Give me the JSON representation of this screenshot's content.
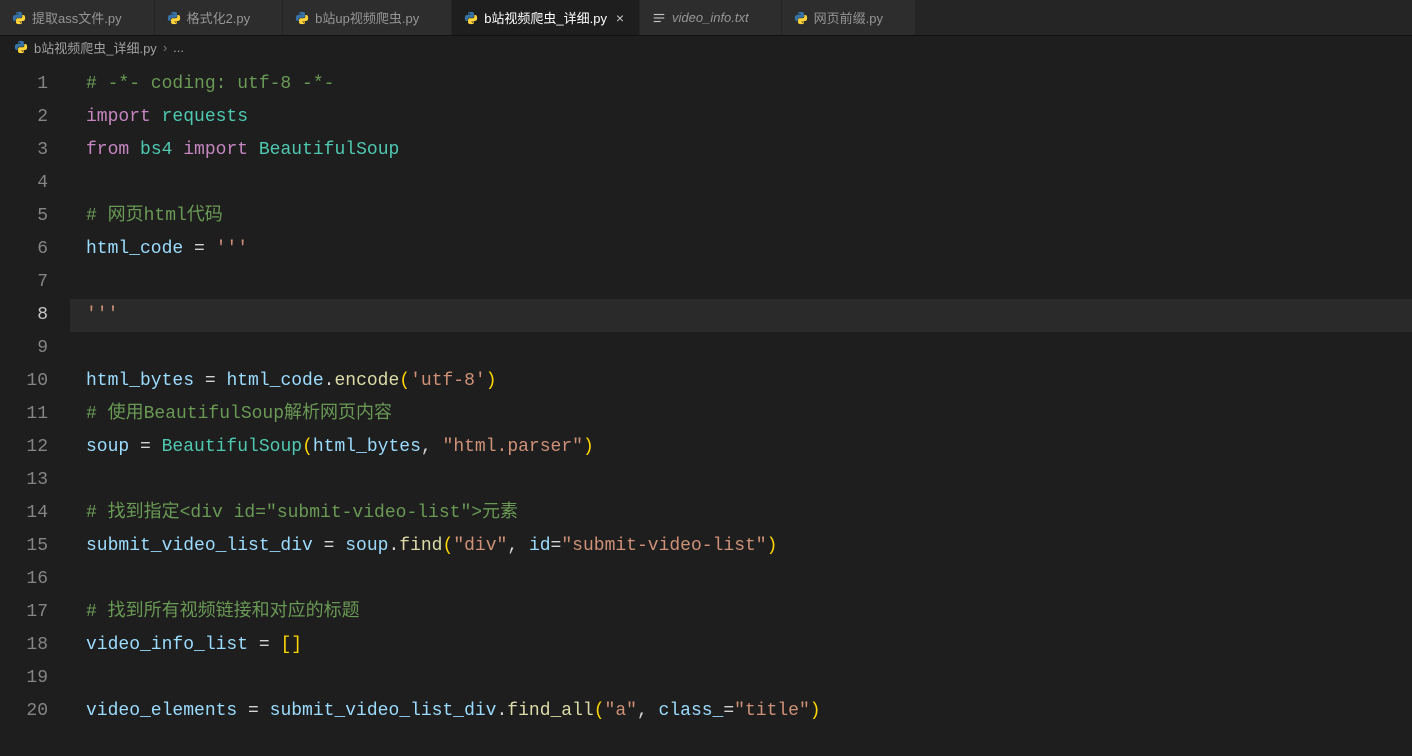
{
  "tabs": [
    {
      "label": "提取ass文件.py",
      "icon": "python",
      "active": false,
      "italic": false
    },
    {
      "label": "格式化2.py",
      "icon": "python",
      "active": false,
      "italic": false
    },
    {
      "label": "b站up视频爬虫.py",
      "icon": "python",
      "active": false,
      "italic": false
    },
    {
      "label": "b站视频爬虫_详细.py",
      "icon": "python",
      "active": true,
      "italic": false
    },
    {
      "label": "video_info.txt",
      "icon": "text",
      "active": false,
      "italic": true
    },
    {
      "label": "网页前缀.py",
      "icon": "python",
      "active": false,
      "italic": false
    }
  ],
  "breadcrumb": {
    "file_icon": "python",
    "file": "b站视频爬虫_详细.py",
    "separator": "›",
    "trail": "..."
  },
  "editor": {
    "current_line": 8,
    "lines": [
      {
        "n": 1,
        "tokens": [
          {
            "t": "# -*- coding: utf-8 -*-",
            "c": "c-comment"
          }
        ]
      },
      {
        "n": 2,
        "tokens": [
          {
            "t": "import",
            "c": "c-keyword"
          },
          {
            "t": " ",
            "c": "c-op"
          },
          {
            "t": "requests",
            "c": "c-module"
          }
        ]
      },
      {
        "n": 3,
        "tokens": [
          {
            "t": "from",
            "c": "c-keyword"
          },
          {
            "t": " ",
            "c": "c-op"
          },
          {
            "t": "bs4",
            "c": "c-module"
          },
          {
            "t": " ",
            "c": "c-op"
          },
          {
            "t": "import",
            "c": "c-keyword"
          },
          {
            "t": " ",
            "c": "c-op"
          },
          {
            "t": "BeautifulSoup",
            "c": "c-module"
          }
        ]
      },
      {
        "n": 4,
        "tokens": []
      },
      {
        "n": 5,
        "tokens": [
          {
            "t": "# 网页html代码",
            "c": "c-comment"
          }
        ]
      },
      {
        "n": 6,
        "tokens": [
          {
            "t": "html_code",
            "c": "c-var"
          },
          {
            "t": " = ",
            "c": "c-op"
          },
          {
            "t": "'''",
            "c": "c-string"
          }
        ]
      },
      {
        "n": 7,
        "tokens": []
      },
      {
        "n": 8,
        "tokens": [
          {
            "t": "'''",
            "c": "c-string"
          }
        ]
      },
      {
        "n": 9,
        "tokens": []
      },
      {
        "n": 10,
        "tokens": [
          {
            "t": "html_bytes",
            "c": "c-var"
          },
          {
            "t": " = ",
            "c": "c-op"
          },
          {
            "t": "html_code",
            "c": "c-var"
          },
          {
            "t": ".",
            "c": "c-op"
          },
          {
            "t": "encode",
            "c": "c-func"
          },
          {
            "t": "(",
            "c": "c-paren gold"
          },
          {
            "t": "'utf-8'",
            "c": "c-string"
          },
          {
            "t": ")",
            "c": "c-paren gold"
          }
        ]
      },
      {
        "n": 11,
        "tokens": [
          {
            "t": "# 使用BeautifulSoup解析网页内容",
            "c": "c-comment"
          }
        ]
      },
      {
        "n": 12,
        "tokens": [
          {
            "t": "soup",
            "c": "c-var"
          },
          {
            "t": " = ",
            "c": "c-op"
          },
          {
            "t": "BeautifulSoup",
            "c": "c-class"
          },
          {
            "t": "(",
            "c": "c-paren gold"
          },
          {
            "t": "html_bytes",
            "c": "c-var"
          },
          {
            "t": ", ",
            "c": "c-op"
          },
          {
            "t": "\"html.parser\"",
            "c": "c-string"
          },
          {
            "t": ")",
            "c": "c-paren gold"
          }
        ]
      },
      {
        "n": 13,
        "tokens": []
      },
      {
        "n": 14,
        "tokens": [
          {
            "t": "# 找到指定<div id=\"submit-video-list\">元素",
            "c": "c-comment"
          }
        ]
      },
      {
        "n": 15,
        "tokens": [
          {
            "t": "submit_video_list_div",
            "c": "c-var"
          },
          {
            "t": " = ",
            "c": "c-op"
          },
          {
            "t": "soup",
            "c": "c-var"
          },
          {
            "t": ".",
            "c": "c-op"
          },
          {
            "t": "find",
            "c": "c-func"
          },
          {
            "t": "(",
            "c": "c-paren gold"
          },
          {
            "t": "\"div\"",
            "c": "c-string"
          },
          {
            "t": ", ",
            "c": "c-op"
          },
          {
            "t": "id",
            "c": "c-var"
          },
          {
            "t": "=",
            "c": "c-op"
          },
          {
            "t": "\"submit-video-list\"",
            "c": "c-string"
          },
          {
            "t": ")",
            "c": "c-paren gold"
          }
        ]
      },
      {
        "n": 16,
        "tokens": []
      },
      {
        "n": 17,
        "tokens": [
          {
            "t": "# 找到所有视频链接和对应的标题",
            "c": "c-comment"
          }
        ]
      },
      {
        "n": 18,
        "tokens": [
          {
            "t": "video_info_list",
            "c": "c-var"
          },
          {
            "t": " = ",
            "c": "c-op"
          },
          {
            "t": "[",
            "c": "c-paren gold"
          },
          {
            "t": "]",
            "c": "c-paren gold"
          }
        ]
      },
      {
        "n": 19,
        "tokens": []
      },
      {
        "n": 20,
        "tokens": [
          {
            "t": "video_elements",
            "c": "c-var"
          },
          {
            "t": " = ",
            "c": "c-op"
          },
          {
            "t": "submit_video_list_div",
            "c": "c-var"
          },
          {
            "t": ".",
            "c": "c-op"
          },
          {
            "t": "find_all",
            "c": "c-func"
          },
          {
            "t": "(",
            "c": "c-paren gold"
          },
          {
            "t": "\"a\"",
            "c": "c-string"
          },
          {
            "t": ", ",
            "c": "c-op"
          },
          {
            "t": "class_",
            "c": "c-var"
          },
          {
            "t": "=",
            "c": "c-op"
          },
          {
            "t": "\"title\"",
            "c": "c-string"
          },
          {
            "t": ")",
            "c": "c-paren gold"
          }
        ]
      }
    ]
  }
}
